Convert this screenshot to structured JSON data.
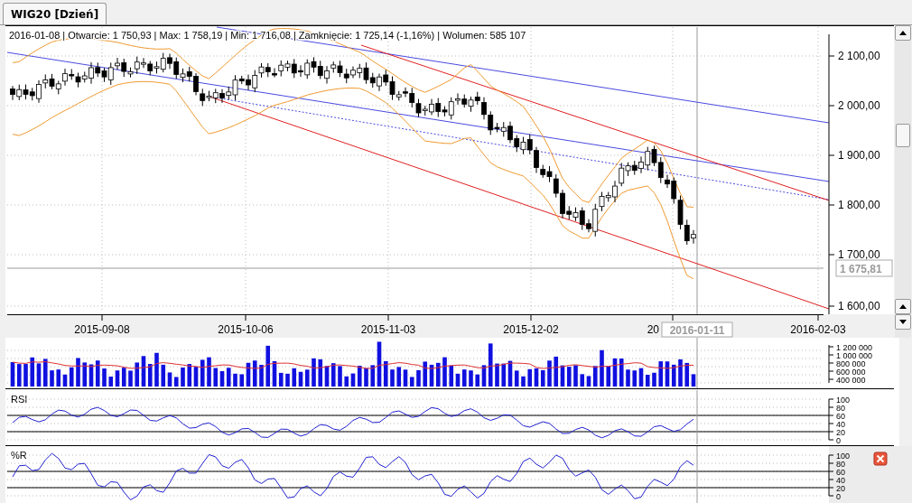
{
  "tabs": [
    {
      "label": "WIG20 [Dzień]",
      "selected": true
    }
  ],
  "ohlc_info": {
    "date": "2016-01-08",
    "separator": "|",
    "fields": [
      {
        "label": "Otwarcie:",
        "value": "1 750,93"
      },
      {
        "label": "Max:",
        "value": "1 758,19"
      },
      {
        "label": "Min:",
        "value": "1 716,08"
      },
      {
        "label": "Zamknięcie:",
        "value": "1 725,14 (-1,16%)"
      },
      {
        "label": "Wolumen:",
        "value": "585 107"
      }
    ]
  },
  "price_axis": {
    "labels": [
      "2 100,00",
      "2 000,00",
      "1 900,00",
      "1 800,00",
      "1 700,00",
      "1 600,00"
    ],
    "current_price": "1 675,81"
  },
  "date_axis": {
    "labels": [
      "2015-09-08",
      "2015-10-06",
      "2015-11-03",
      "2015-12-02",
      "20",
      "2016-02-03"
    ],
    "cursor_date": "2016-01-11"
  },
  "volume_panel": {
    "axis_labels": [
      "1 200 000",
      "1 000 000",
      "800 000",
      "600 000",
      "400 000"
    ]
  },
  "rsi_panel": {
    "title": "RSI",
    "axis_labels": [
      "100",
      "80",
      "60",
      "40",
      "20",
      "0"
    ]
  },
  "williams_panel": {
    "title": "%R",
    "axis_labels": [
      "100",
      "80",
      "60",
      "40",
      "20",
      "0"
    ]
  }
}
